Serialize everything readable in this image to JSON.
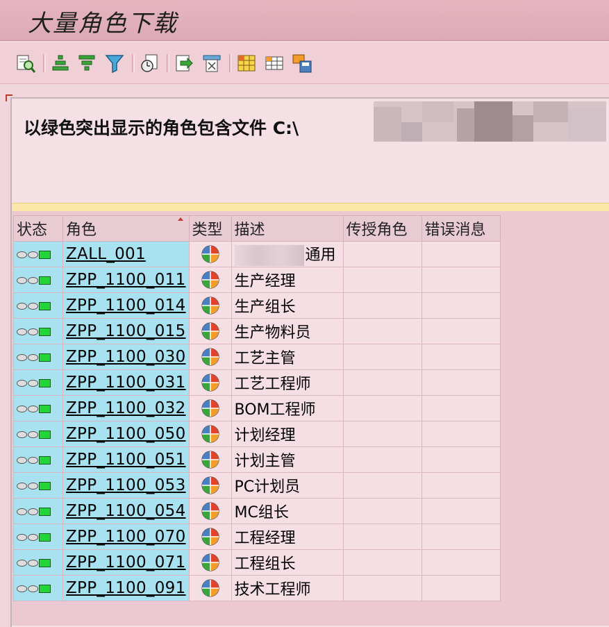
{
  "window": {
    "title": "大量角色下载"
  },
  "toolbar": {
    "buttons": [
      {
        "icon": "find-icon"
      },
      {
        "icon": "sort-ascending-icon"
      },
      {
        "icon": "sort-descending-icon"
      },
      {
        "icon": "filter-icon"
      },
      {
        "icon": "total-icon"
      },
      {
        "icon": "export-icon"
      },
      {
        "icon": "print-preview-icon"
      },
      {
        "icon": "layout-grid-icon"
      },
      {
        "icon": "change-layout-icon"
      },
      {
        "icon": "save-layout-icon"
      }
    ]
  },
  "header": {
    "message": "以绿色突出显示的角色包含文件 C:\\"
  },
  "table": {
    "columns": [
      "状态",
      "角色",
      "类型",
      "描述",
      "传授角色",
      "错误消息"
    ],
    "rows": [
      {
        "role": "ZALL_001",
        "desc": "通用",
        "desc_redacted": true
      },
      {
        "role": "ZPP_1100_011",
        "desc": "生产经理"
      },
      {
        "role": "ZPP_1100_014",
        "desc": "生产组长"
      },
      {
        "role": "ZPP_1100_015",
        "desc": "生产物料员"
      },
      {
        "role": "ZPP_1100_030",
        "desc": "工艺主管"
      },
      {
        "role": "ZPP_1100_031",
        "desc": "工艺工程师"
      },
      {
        "role": "ZPP_1100_032",
        "desc": "BOM工程师"
      },
      {
        "role": "ZPP_1100_050",
        "desc": "计划经理"
      },
      {
        "role": "ZPP_1100_051",
        "desc": "计划主管"
      },
      {
        "role": "ZPP_1100_053",
        "desc": "PC计划员"
      },
      {
        "role": "ZPP_1100_054",
        "desc": "MC组长"
      },
      {
        "role": "ZPP_1100_070",
        "desc": "工程经理"
      },
      {
        "role": "ZPP_1100_071",
        "desc": "工程组长"
      },
      {
        "role": "ZPP_1100_091",
        "desc": "技术工程师"
      }
    ]
  },
  "colors": {
    "status_green": "#22d63a",
    "highlight_cyan": "#a8e2f0",
    "background_pink": "#f1d5dc"
  }
}
